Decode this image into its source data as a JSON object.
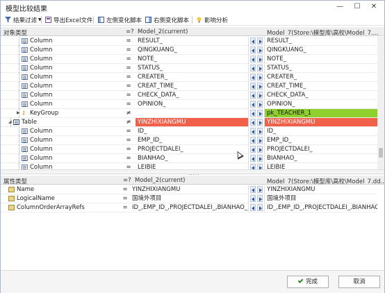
{
  "window": {
    "title": "模型比较结果",
    "minimize": "—",
    "maximize": "☐",
    "close": "✕"
  },
  "toolbar": {
    "filter_label": "结果过滤",
    "export_label": "导出Excel文件",
    "left_script_label": "左侧变化脚本",
    "right_script_label": "右侧变化脚本",
    "impact_label": "影响分析"
  },
  "top_grid": {
    "header": {
      "type": "对象类型",
      "cmp": "=?",
      "left": "Model_2(current)",
      "right": "Model_7(Store:\\模型库\\高校\\Model_7...."
    },
    "rows": [
      {
        "type": "Column",
        "op": "=",
        "left": "RESULT_",
        "right": "RESULT_",
        "status": "same",
        "kind": "column"
      },
      {
        "type": "Column",
        "op": "=",
        "left": "QINGKUANG_",
        "right": "QINGKUANG_",
        "status": "same",
        "kind": "column"
      },
      {
        "type": "Column",
        "op": "=",
        "left": "NOTE_",
        "right": "NOTE_",
        "status": "same",
        "kind": "column"
      },
      {
        "type": "Column",
        "op": "=",
        "left": "STATUS_",
        "right": "STATUS_",
        "status": "same",
        "kind": "column"
      },
      {
        "type": "Column",
        "op": "=",
        "left": "CREATER_",
        "right": "CREATER_",
        "status": "same",
        "kind": "column"
      },
      {
        "type": "Column",
        "op": "=",
        "left": "CREAT_TIME_",
        "right": "CREAT_TIME_",
        "status": "same",
        "kind": "column"
      },
      {
        "type": "Column",
        "op": "=",
        "left": "CHECK_DATA_",
        "right": "CHECK_DATA_",
        "status": "same",
        "kind": "column"
      },
      {
        "type": "Column",
        "op": "=",
        "left": "OPINION_",
        "right": "OPINION_",
        "status": "same",
        "kind": "column"
      },
      {
        "type": "KeyGroup",
        "op": "≠",
        "left": "",
        "right": "pk_TEACHER_1",
        "status": "added",
        "kind": "keygroup"
      },
      {
        "type": "Table",
        "op": "≠",
        "left": "YINZHIXIANGMU",
        "right": "YINZHIXIANGMU",
        "status": "changed",
        "kind": "table"
      },
      {
        "type": "Column",
        "op": "=",
        "left": "ID_",
        "right": "ID_",
        "status": "same",
        "kind": "column"
      },
      {
        "type": "Column",
        "op": "=",
        "left": "EMP_ID_",
        "right": "EMP_ID_",
        "status": "same",
        "kind": "column"
      },
      {
        "type": "Column",
        "op": "=",
        "left": "PROJECTDALEI_",
        "right": "PROJECTDALEI_",
        "status": "same",
        "kind": "column"
      },
      {
        "type": "Column",
        "op": "=",
        "left": "BIANHAO_",
        "right": "BIANHAO_",
        "status": "same",
        "kind": "column"
      },
      {
        "type": "Column",
        "op": "=",
        "left": "LEIBIE_",
        "right": "LEIBIE_",
        "status": "same",
        "kind": "column"
      }
    ]
  },
  "bottom_grid": {
    "header": {
      "type": "属性类型",
      "cmp": "=?",
      "left": "Model_2(current)",
      "right": "Model_7(Store:\\模型库\\高校\\Model_7.dd..."
    },
    "rows": [
      {
        "type": "Name",
        "op": "=",
        "left": "YINZHIXIANGMU",
        "right": "YINZHIXIANGMU"
      },
      {
        "type": "LogicalName",
        "op": "=",
        "left": "国境外项目",
        "right": "国境外项目"
      },
      {
        "type": "ColumnOrderArrayRefs",
        "op": "=",
        "left": "ID_,EMP_ID_,PROJECTDALEI_,BIANHAO_,L...",
        "right": "ID_,EMP_ID_,PROJECTDALEI_,BIANHAO_,LEI..."
      }
    ]
  },
  "footer": {
    "ok_label": "完成",
    "cancel_label": "取消"
  },
  "colors": {
    "changed": "#f2604a",
    "added": "#8fcf2e",
    "accent": "#2d5aa8"
  }
}
